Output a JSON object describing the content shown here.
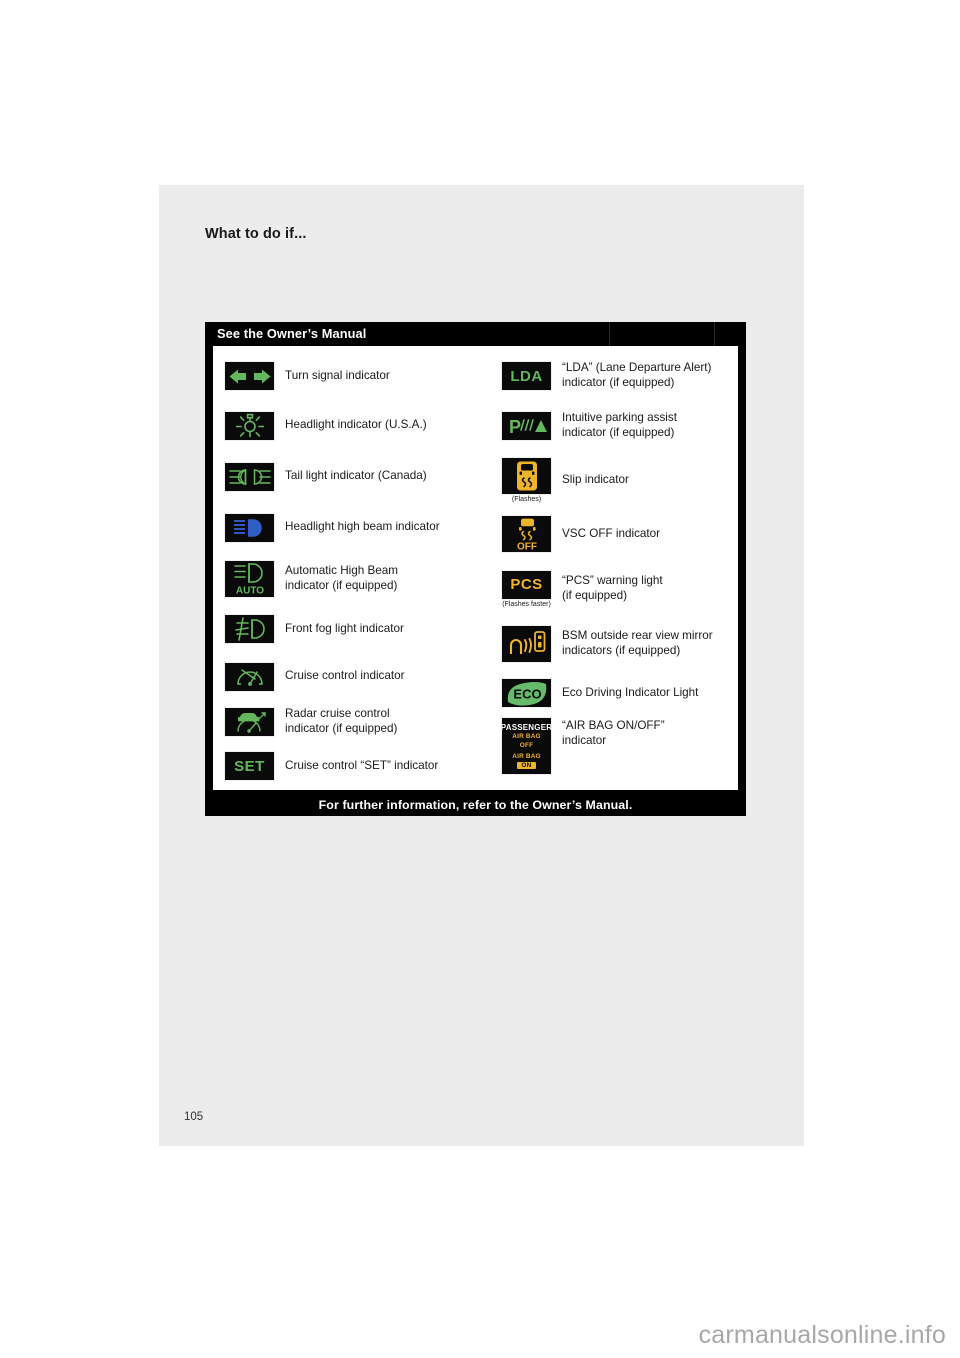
{
  "page": {
    "heading": "What to do if...",
    "number": "105",
    "watermark": "carmanualsonline.info"
  },
  "table": {
    "title": "See the Owner’s Manual",
    "footer": "For further information, refer to the Owner’s Manual.",
    "left_column": [
      {
        "icon": "turn-signal-arrows-icon",
        "icon_color": "#64b75c",
        "label_line1": "Turn signal indicator",
        "label_line2": "",
        "note": ""
      },
      {
        "icon": "headlight-indicator-icon",
        "icon_color": "#64b75c",
        "label_line1": "Headlight indicator (U.S.A.)",
        "label_line2": "",
        "note": ""
      },
      {
        "icon": "tail-light-indicator-icon",
        "icon_color": "#64b75c",
        "label_line1": "Tail light indicator (Canada)",
        "label_line2": "",
        "note": ""
      },
      {
        "icon": "high-beam-icon",
        "icon_color": "#2f5fc4",
        "label_line1": "Headlight high beam indicator",
        "label_line2": "",
        "note": ""
      },
      {
        "icon": "automatic-high-beam-icon",
        "icon_color": "#64b75c",
        "icon_text": "AUTO",
        "label_line1": "Automatic High Beam",
        "label_line2": "indicator (if equipped)",
        "note": ""
      },
      {
        "icon": "front-fog-light-icon",
        "icon_color": "#64b75c",
        "label_line1": "Front fog light indicator",
        "label_line2": "",
        "note": ""
      },
      {
        "icon": "cruise-control-icon",
        "icon_color": "#64b75c",
        "label_line1": "Cruise control indicator",
        "label_line2": "",
        "note": ""
      },
      {
        "icon": "radar-cruise-control-icon",
        "icon_color": "#64b75c",
        "label_line1": "Radar cruise control",
        "label_line2": "indicator (if equipped)",
        "note": ""
      },
      {
        "icon": "cruise-set-icon",
        "icon_color": "#64b75c",
        "icon_text": "SET",
        "label_line1": "Cruise control “SET” indicator",
        "label_line2": "",
        "note": ""
      }
    ],
    "right_column": [
      {
        "icon": "lda-icon",
        "icon_color": "#64b75c",
        "icon_text": "LDA",
        "label_line1": "“LDA” (Lane Departure Alert)",
        "label_line2": "indicator (if equipped)",
        "note": ""
      },
      {
        "icon": "intuitive-parking-assist-icon",
        "icon_color": "#64b75c",
        "icon_text": "P",
        "label_line1": "Intuitive parking assist",
        "label_line2": "indicator (if equipped)",
        "note": ""
      },
      {
        "icon": "slip-indicator-icon",
        "icon_color": "#f0b42a",
        "label_line1": "Slip indicator",
        "label_line2": "",
        "note": "(Flashes)"
      },
      {
        "icon": "vsc-off-icon",
        "icon_color": "#f0b42a",
        "icon_text": "OFF",
        "label_line1": "VSC OFF indicator",
        "label_line2": "",
        "note": ""
      },
      {
        "icon": "pcs-warning-icon",
        "icon_color": "#f0b42a",
        "icon_text": "PCS",
        "label_line1": "“PCS” warning light",
        "label_line2": "(if equipped)",
        "note": "(Flashes faster)"
      },
      {
        "icon": "bsm-mirror-icon",
        "icon_color": "#f0b42a",
        "label_line1": "BSM outside rear view mirror",
        "label_line2": "indicators (if equipped)",
        "note": ""
      },
      {
        "icon": "eco-driving-icon",
        "icon_color": "#64b75c",
        "icon_text": "ECO",
        "label_line1": "Eco Driving Indicator Light",
        "label_line2": "",
        "note": ""
      },
      {
        "icon": "air-bag-on-off-icon",
        "icon_color": "#f0b42a",
        "icon_text_passenger": "PASSENGER",
        "icon_text_airbag": "AIR BAG",
        "icon_text_off": "OFF",
        "icon_text_on": "ON",
        "label_line1": "“AIR BAG ON/OFF”",
        "label_line2": "indicator",
        "note": ""
      }
    ]
  }
}
